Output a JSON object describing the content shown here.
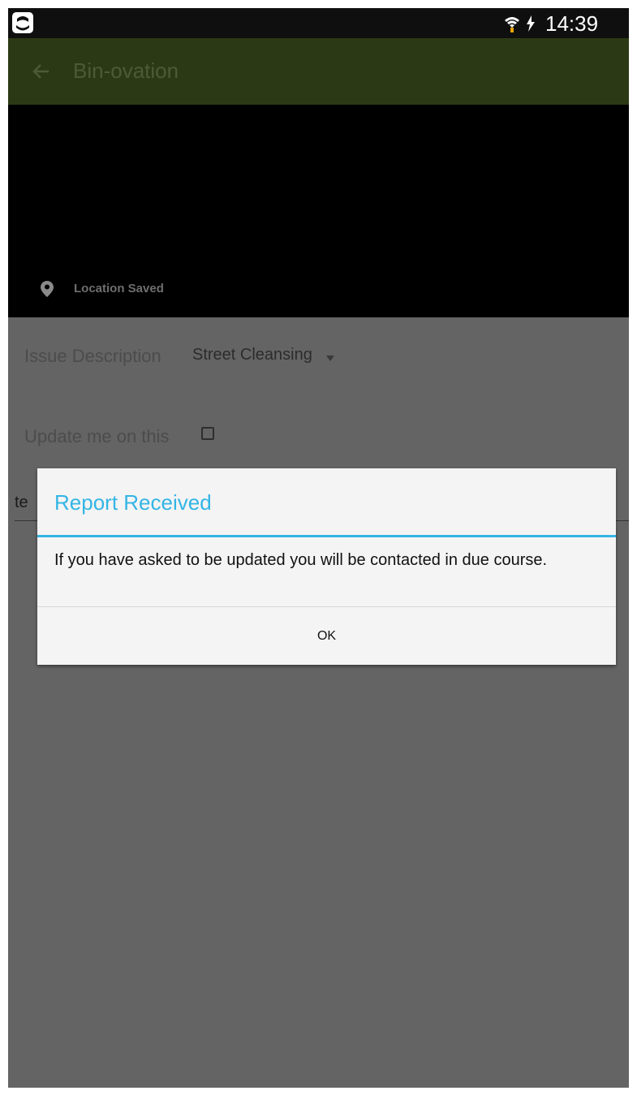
{
  "status_bar": {
    "time": "14:39",
    "icons": [
      "app-notification-icon",
      "wifi-icon",
      "battery-charging-icon"
    ]
  },
  "app_bar": {
    "title": "Bin-ovation",
    "back_icon": "arrow-left-icon"
  },
  "preview": {
    "location_text": "Location Saved",
    "pin_icon": "map-pin-icon"
  },
  "form": {
    "issue_label": "Issue Description",
    "issue_value": "Street Cleansing",
    "update_label": "Update me on this",
    "update_checked": false,
    "comment_value": "te"
  },
  "dialog": {
    "title": "Report Received",
    "message": "If you have asked to be updated you will be contacted in due course.",
    "ok_label": "OK"
  },
  "colors": {
    "dialog_accent": "#33b5e5",
    "app_bar": "#2b3a14",
    "overlay_background": "#646464"
  }
}
